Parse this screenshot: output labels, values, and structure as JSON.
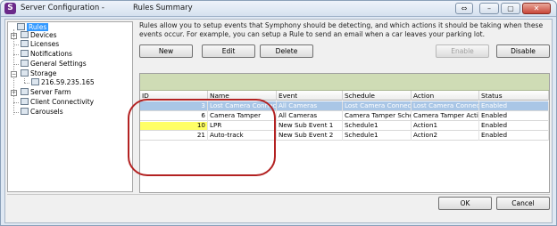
{
  "window": {
    "title_left": "Server Configuration -",
    "title_right": "Rules Summary",
    "app_icon_letter": "S",
    "controls": [
      "⇔",
      "–",
      "▢",
      "✕"
    ]
  },
  "tree": {
    "items": [
      {
        "label": "Rules",
        "icon": "rules-icon",
        "selected": true
      },
      {
        "label": "Devices",
        "icon": "devices-icon"
      },
      {
        "label": "Licenses",
        "icon": "licenses-icon"
      },
      {
        "label": "Notifications",
        "icon": "notifications-icon"
      },
      {
        "label": "General Settings",
        "icon": "settings-icon"
      },
      {
        "label": "Storage",
        "icon": "storage-icon"
      },
      {
        "label": "216.59.235.165",
        "icon": "server-icon"
      },
      {
        "label": "Server Farm",
        "icon": "server-farm-icon"
      },
      {
        "label": "Client Connectivity",
        "icon": "client-icon"
      },
      {
        "label": "Carousels",
        "icon": "carousel-icon"
      }
    ]
  },
  "main": {
    "description": "Rules allow you to setup events that Symphony should be detecting, and which actions it should be taking when these events occur. For example, you can setup a Rule to send an email when a car leaves your parking lot.",
    "buttons": {
      "new": "New",
      "edit": "Edit",
      "delete": "Delete",
      "enable": "Enable",
      "disable": "Disable"
    },
    "grid": {
      "columns": [
        "ID",
        "Name",
        "Event",
        "Schedule",
        "Action",
        "Status"
      ],
      "rows": [
        {
          "id": "3",
          "name": "Lost Camera Connection",
          "event": "All Cameras",
          "schedule": "Lost Camera Connecti...",
          "action": "Lost Camera Connecti...",
          "status": "Enabled"
        },
        {
          "id": "6",
          "name": "Camera Tamper",
          "event": "All Cameras",
          "schedule": "Camera Tamper Sche...",
          "action": "Camera Tamper Action",
          "status": "Enabled"
        },
        {
          "id": "10",
          "name": "LPR",
          "event": "New Sub Event 1",
          "schedule": "Schedule1",
          "action": "Action1",
          "status": "Enabled"
        },
        {
          "id": "21",
          "name": "Auto-track",
          "event": "New Sub Event 2",
          "schedule": "Schedule1",
          "action": "Action2",
          "status": "Enabled"
        }
      ]
    }
  },
  "footer": {
    "ok": "OK",
    "cancel": "Cancel"
  },
  "colors": {
    "selection": "#3399ff",
    "row_selected": "#a9c6e6",
    "group_band": "#cfdcb5",
    "highlight": "#ffff66",
    "annotation": "#b32222"
  }
}
